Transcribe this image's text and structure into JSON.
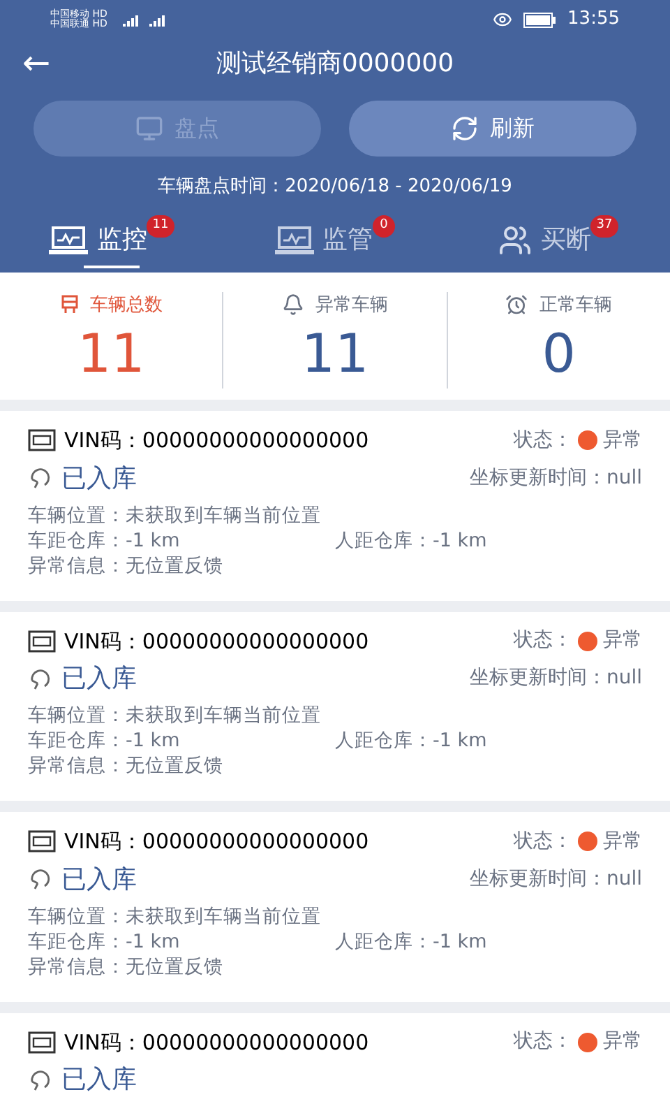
{
  "status_bar": {
    "carriers": [
      "中国移动 HD",
      "中国联通 HD"
    ],
    "time": "13:55"
  },
  "header": {
    "back": "←",
    "title": "测试经销商0000000"
  },
  "actions": [
    {
      "kind": "inventory",
      "label": "盘点",
      "disabled": true
    },
    {
      "kind": "refresh",
      "label": "刷新",
      "disabled": false
    }
  ],
  "period": "车辆盘点时间：2020/06/18 - 2020/06/19",
  "tabs": [
    {
      "kind": "monitor",
      "label": "监控",
      "badge": "11",
      "selected": true
    },
    {
      "kind": "monitor",
      "label": "监管",
      "badge": "0",
      "selected": false
    },
    {
      "kind": "people",
      "label": "买断",
      "badge": "37",
      "selected": false
    }
  ],
  "stats": [
    {
      "kind": "total",
      "label": "车辆总数",
      "value": "11",
      "color": "#e0553a"
    },
    {
      "kind": "bell",
      "label": "异常车辆",
      "value": "11",
      "color": "#3a5a94"
    },
    {
      "kind": "clock",
      "label": "正常车辆",
      "value": "0",
      "color": "#3a5a94"
    }
  ],
  "vehicles": [
    {
      "vin": "VIN码：00000000000000000",
      "status_label": "状态：",
      "status": "异常",
      "color": "#ee5a30",
      "stock": "已入库",
      "coord_time": "坐标更新时间：null",
      "location": "车辆位置：未获取到车辆当前位置",
      "car_dist": "车距仓库：-1 km",
      "person_dist": "人距仓库：-1 km",
      "error": "异常信息：无位置反馈"
    },
    {
      "vin": "VIN码：00000000000000000",
      "status_label": "状态：",
      "status": "异常",
      "color": "#ee5a30",
      "stock": "已入库",
      "coord_time": "坐标更新时间：null",
      "location": "车辆位置：未获取到车辆当前位置",
      "car_dist": "车距仓库：-1 km",
      "person_dist": "人距仓库：-1 km",
      "error": "异常信息：无位置反馈"
    },
    {
      "vin": "VIN码：00000000000000000",
      "status_label": "状态：",
      "status": "异常",
      "color": "#ee5a30",
      "stock": "已入库",
      "coord_time": "坐标更新时间：null",
      "location": "车辆位置：未获取到车辆当前位置",
      "car_dist": "车距仓库：-1 km",
      "person_dist": "人距仓库：-1 km",
      "error": "异常信息：无位置反馈"
    },
    {
      "vin": "VIN码：00000000000000000",
      "status_label": "状态：",
      "status": "异常",
      "color": "#ee5a30",
      "stock": "已入库"
    }
  ]
}
